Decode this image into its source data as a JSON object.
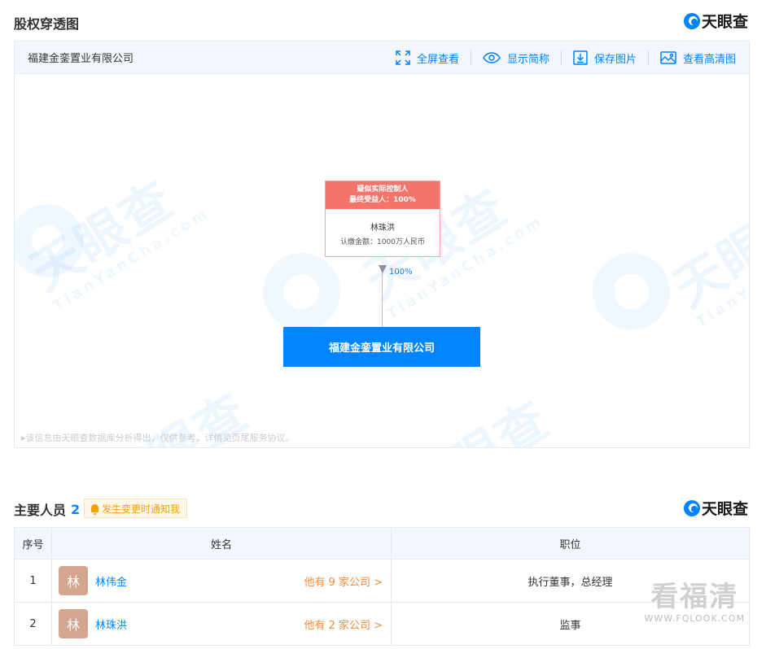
{
  "equity": {
    "title": "股权穿透图",
    "brand": "天眼查",
    "company_name": "福建金銮置业有限公司",
    "actions": [
      {
        "label": "全屏查看",
        "icon": "fullscreen-icon"
      },
      {
        "label": "显示简称",
        "icon": "eye-icon"
      },
      {
        "label": "保存图片",
        "icon": "download-icon"
      },
      {
        "label": "查看高清图",
        "icon": "image-icon"
      }
    ],
    "holder": {
      "tag_line1": "疑似实际控制人",
      "tag_line2": "最终受益人：100%",
      "name": "林珠洪",
      "capital": "认缴金额：1000万人民币"
    },
    "edge_percent": "100%",
    "target_company": "福建金銮置业有限公司",
    "disclaimer": "▸该信息由天眼查数据库分析得出，仅供参考，详情见页尾服务协议。",
    "watermark_cn": "天眼查",
    "watermark_en": "TianYanCha.com"
  },
  "personnel": {
    "title": "主要人员",
    "count": "2",
    "notify_label": "发生变更时通知我",
    "brand": "天眼查",
    "headers": {
      "index": "序号",
      "name": "姓名",
      "position": "职位"
    },
    "rows": [
      {
        "index": "1",
        "avatar": "林",
        "name": "林伟金",
        "companies": "他有 9 家公司 >",
        "position": "执行董事，总经理"
      },
      {
        "index": "2",
        "avatar": "林",
        "name": "林珠洪",
        "companies": "他有 2 家公司 >",
        "position": "监事"
      }
    ]
  },
  "site_watermark": {
    "cn": "看福清",
    "en": "WWW.FQLOOK.COM"
  },
  "colors": {
    "accent": "#0084ff",
    "holder_red": "#f4746c",
    "link_orange": "#f08c3c"
  }
}
